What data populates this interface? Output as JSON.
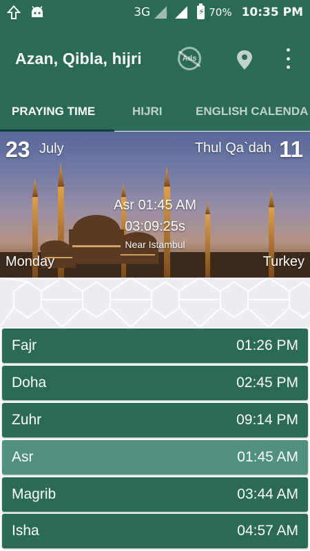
{
  "status_bar": {
    "network": "3G",
    "battery": "70%",
    "time": "10:35 PM"
  },
  "app_bar": {
    "title": "Azan, Qibla, hijri",
    "ads_label": "Ads",
    "icons": [
      "upload-icon",
      "android-icon",
      "remove-ads-icon",
      "location-pin-icon",
      "more-vert-icon"
    ]
  },
  "tabs": [
    {
      "label": "PRAYING TIME",
      "active": true
    },
    {
      "label": "HIJRI",
      "active": false
    },
    {
      "label": "ENGLISH CALENDA",
      "active": false
    }
  ],
  "hero": {
    "gregorian_day": "23",
    "gregorian_month": "July",
    "hijri_month": "Thul Qa`dah",
    "hijri_day": "11",
    "current_prayer": "Asr 01:45 AM",
    "countdown": "03:09:25s",
    "location": "Near Istambul",
    "weekday": "Monday",
    "country": "Turkey"
  },
  "prayers": [
    {
      "name": "Fajr",
      "time": "01:26 PM",
      "current": false
    },
    {
      "name": "Doha",
      "time": "02:45 PM",
      "current": false
    },
    {
      "name": "Zuhr",
      "time": "09:14 PM",
      "current": false
    },
    {
      "name": "Asr",
      "time": "01:45 AM",
      "current": true
    },
    {
      "name": "Magrib",
      "time": "03:44 AM",
      "current": false
    },
    {
      "name": "Isha",
      "time": "04:57 AM",
      "current": false
    }
  ],
  "colors": {
    "primary": "#2b6a56",
    "current_row": "#4f907e",
    "tab_indicator": "#0f3f31"
  }
}
